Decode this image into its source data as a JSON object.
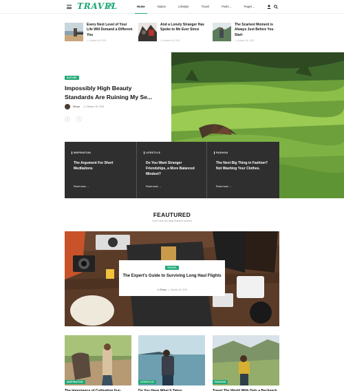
{
  "brand": {
    "logo_text": "TRAVEL"
  },
  "nav": {
    "items": [
      {
        "label": "Home",
        "active": true,
        "dropdown": false
      },
      {
        "label": "Nature",
        "active": false,
        "dropdown": false
      },
      {
        "label": "Lifestyle",
        "active": false,
        "dropdown": false
      },
      {
        "label": "Travel",
        "active": false,
        "dropdown": false
      },
      {
        "label": "Posts",
        "active": false,
        "dropdown": true
      },
      {
        "label": "Pages",
        "active": false,
        "dropdown": true
      }
    ],
    "icons": [
      "user-icon",
      "search-icon"
    ]
  },
  "top_posts": [
    {
      "title": "Every Next Level of Your Life Will Demand a Different You",
      "date": "October 18, 2019"
    },
    {
      "title": "And a Lonely Stranger Has Spoke to Me Ever Since",
      "date": "October 18, 2019"
    },
    {
      "title": "The Scariest Moment is Always Just Before You Start",
      "date": "October 18, 2019"
    }
  ],
  "hero": {
    "badge": "Nature",
    "title": "Impossibly High Beauty Standards Are Ruining My Se...",
    "author": "Elenyz",
    "date": "October 18, 2019",
    "prev_label": "‹",
    "next_label": "›"
  },
  "panel_posts": [
    {
      "category": "Inspiration",
      "title": "The Argument For Short Meditations",
      "read_more": "Read more"
    },
    {
      "category": "Lifestyle",
      "title": "Do You Want Stranger Friendships, a More Balanced Mindset?",
      "read_more": "Read more"
    },
    {
      "category": "Fashion",
      "title": "The Next Big Thing in Fashion? Not Washing Your Clothes.",
      "read_more": "Read more"
    }
  ],
  "featured": {
    "heading": "FEAUTURED",
    "subheading": "Don't miss the daily featured articles",
    "card": {
      "badge": "Travel",
      "title": "The Expert's Guide to Surviving Long Haul Flights",
      "by_label": "by",
      "author": "Elenyz",
      "date": "October 18, 2019"
    }
  },
  "grid_posts": [
    {
      "badge": "Inspiration",
      "title": "The Importance of Cultivating Fun"
    },
    {
      "badge": "Lifestyle",
      "title": "Do You Have What It Takes"
    },
    {
      "badge": "Fashion",
      "title": "Travel The World With Only a Backpack"
    }
  ],
  "colors": {
    "accent": "#1fa876",
    "panel": "#2f2f2f"
  }
}
